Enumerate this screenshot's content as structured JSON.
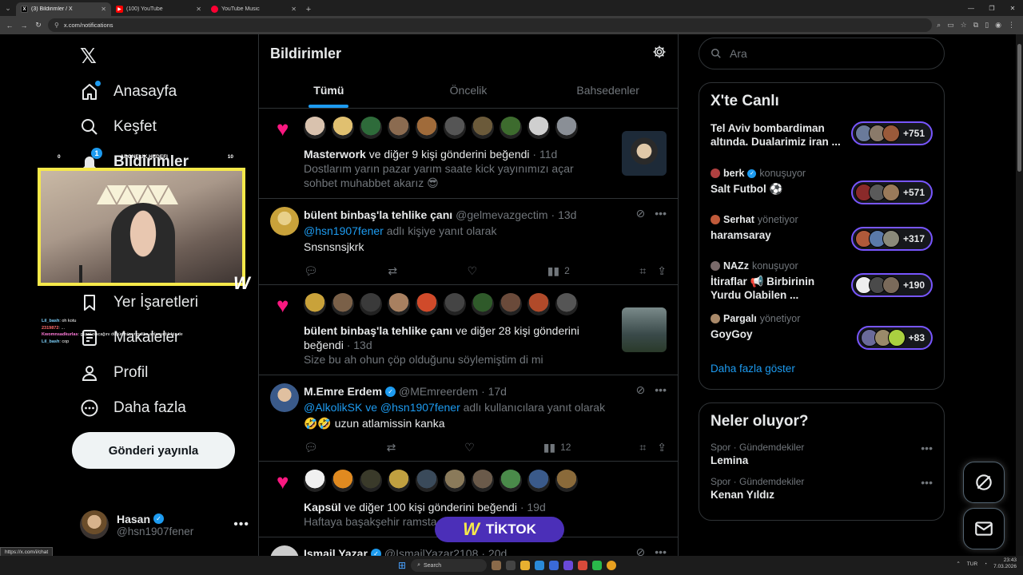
{
  "browser": {
    "tabs": [
      {
        "title": "(3) Bildirimler / X",
        "fav": "X",
        "fav_color": "#000000",
        "active": true
      },
      {
        "title": "(100) YouTube",
        "fav": "▶",
        "fav_color": "#ff0000",
        "active": false
      },
      {
        "title": "YouTube Music",
        "fav": "●",
        "fav_color": "#ff0033",
        "active": false
      }
    ],
    "url": "x.com/notifications"
  },
  "nav": {
    "items": [
      {
        "key": "home",
        "label": "Anasayfa",
        "icon": "home-icon"
      },
      {
        "key": "explore",
        "label": "Keşfet",
        "icon": "search-icon"
      },
      {
        "key": "notifications",
        "label": "Bildirimler",
        "icon": "bell-icon",
        "badge": "1"
      },
      {
        "key": "bookmarks",
        "label": "Yer İşaretleri",
        "icon": "bookmark-icon"
      },
      {
        "key": "articles",
        "label": "Makaleler",
        "icon": "article-icon"
      },
      {
        "key": "profile",
        "label": "Profil",
        "icon": "user-icon"
      },
      {
        "key": "more",
        "label": "Daha fazla",
        "icon": "more-circle-icon"
      }
    ],
    "post_button": "Gönderi yayınla",
    "account": {
      "name": "Hasan",
      "handle": "@hsn1907fener"
    }
  },
  "overlay": {
    "goal_left": "0",
    "goal_title": "ABONELIK HEDEFI",
    "goal_right": "10",
    "chat": [
      {
        "user": "Lil_bash",
        "text": ": oh kotu"
      },
      {
        "user": "2319872",
        "text": ": ..."
      },
      {
        "user": "Kwomnsadkurlas",
        "text": ": güzel olacağını düşünmüyor galiba anlamadık biz de"
      },
      {
        "user": "Lil_bash",
        "text": ": cop"
      }
    ],
    "tiktok": "TİKTOK"
  },
  "center": {
    "title": "Bildirimler",
    "tabs": [
      "Tümü",
      "Öncelik",
      "Bahsedenler"
    ],
    "notifications": [
      {
        "type": "like",
        "actor": "Masterwork",
        "rest": " ve diğer 9 kişi gönderini beğendi",
        "time": "· 11d",
        "text": "Dostlarım yarın pazar yarım saate kick yayınımızı açar sohbet muhabbet akarız 😎",
        "avatars": [
          "#d9c2ae",
          "#e0c070",
          "#2e6b3a",
          "#8b6b50",
          "#a06b3a",
          "#555555",
          "#6b5a3a",
          "#3d6b2e",
          "#cfcfcf",
          "#8a8f96"
        ],
        "thumb": "#1d2a38"
      },
      {
        "type": "reply",
        "name": "bülent binbaş'la tehlike çanı",
        "handle": "@gelmevazgectim",
        "time": "· 13d",
        "reply_prefix": "",
        "reply_to": "@hsn1907fener",
        "reply_suffix": " adlı kişiye yanıt olarak",
        "text": "Snsnsnsjkrk",
        "views": "2",
        "avatar": "#c9a23a"
      },
      {
        "type": "like",
        "actor": "bülent binbaş'la tehlike çanı",
        "rest": " ve diğer 28 kişi gönderini beğendi",
        "time": "· 13d",
        "text": "Size bu ah ohun çöp olduğunu söylemiştim di mi",
        "avatars": [
          "#c9a23a",
          "#7a6048",
          "#3a3a3a",
          "#a88060",
          "#d04a2a",
          "#444444",
          "#2f5a2a",
          "#6a4a3a",
          "#b04a2a",
          "#555555"
        ],
        "thumb": "#4a5a4a"
      },
      {
        "type": "reply",
        "name": "M.Emre Erdem",
        "handle": "@MEmreerdem",
        "time": "· 17d",
        "reply_prefix": "",
        "reply_to": "@AlkolikSK ve @hsn1907fener",
        "reply_suffix": " adlı kullanıcılara yanıt olarak",
        "text": "🤣🤣 uzun atlamissin kanka",
        "views": "12",
        "avatar": "#3a5a8a",
        "verified": true
      },
      {
        "type": "like",
        "actor": "Kapsül",
        "rest": " ve diğer 100 kişi gönderini beğendi",
        "time": "· 19d",
        "text": "Haftaya başakşehir ramsta ... forma ... fayda bekle",
        "avatars": [
          "#f0f0f0",
          "#e08a20",
          "#3a3a2a",
          "#c0a040",
          "#3a4a5a",
          "#8a7a5a",
          "#6a5a4a",
          "#4a8a4a",
          "#3a5a8a",
          "#8a6a3a"
        ]
      },
      {
        "type": "reply",
        "name": "Ismail Yazar",
        "handle": "@IsmailYazar2108",
        "time": "· 20d",
        "avatar": "#cccccc",
        "verified": true
      }
    ]
  },
  "right": {
    "search_placeholder": "Ara",
    "live_title": "X'te Canlı",
    "live": [
      {
        "host": "",
        "role": "",
        "title": "Tel Aviv bombardiman altında. Dualarimiz iran ...",
        "count": "+751",
        "colors": [
          "#6a7a9a",
          "#8a7a6a",
          "#9a5a3a"
        ]
      },
      {
        "host": "berk",
        "role": "konuşuyor",
        "verified": true,
        "title": "Salt Futbol ⚽",
        "count": "+571",
        "colors": [
          "#8a2a2a",
          "#5a5a5a",
          "#9a7a5a"
        ],
        "host_color": "#b04040"
      },
      {
        "host": "Serhat",
        "role": "yönetiyor",
        "title": "haramsaray",
        "count": "+317",
        "colors": [
          "#b05a3a",
          "#5a7aaa",
          "#8a8a7a"
        ],
        "host_color": "#c05a3a"
      },
      {
        "host": "NAZz",
        "role": "konuşuyor",
        "title": "İtiraflar 📢 Birbirinin Yurdu Olabilen ...",
        "count": "+190",
        "colors": [
          "#eeeeee",
          "#4a4a4a",
          "#7a6a5a"
        ],
        "host_color": "#7a6a6a"
      },
      {
        "host": "Pargalı",
        "role": "yönetiyor",
        "title": "GoyGoy",
        "count": "+83",
        "colors": [
          "#6a6a9a",
          "#9a8a6a",
          "#aad040"
        ],
        "host_color": "#aa8a6a"
      }
    ],
    "show_more": "Daha fazla göster",
    "trends_title": "Neler oluyor?",
    "trends": [
      {
        "category": "Spor · Gündemdekiler",
        "name": "Lemina"
      },
      {
        "category": "Spor · Gündemdekiler",
        "name": "Kenan Yıldız"
      }
    ]
  },
  "status_url": "https://x.com/i/chat",
  "taskbar": {
    "search": "Search",
    "lang": "TUR",
    "time": "23:43",
    "date": "7.03.2026"
  },
  "accent": "#1d9bf0",
  "like_color": "#f91880"
}
